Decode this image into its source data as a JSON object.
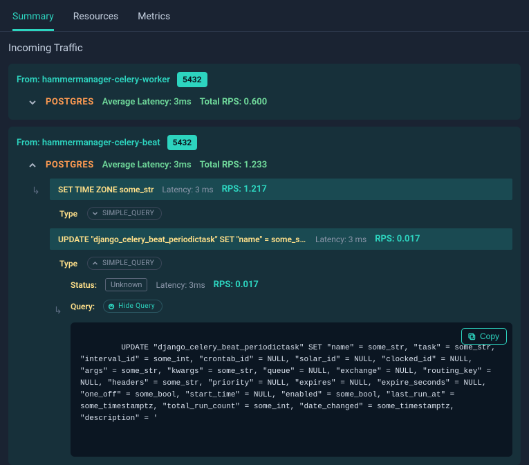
{
  "tabs": {
    "summary": "Summary",
    "resources": "Resources",
    "metrics": "Metrics"
  },
  "section_title": "Incoming Traffic",
  "sources": [
    {
      "from_label": "From: hammermanager-celery-worker",
      "port": "5432",
      "proto": "POSTGRES",
      "latency": "Average Latency: 3ms",
      "rps": "Total RPS: 0.600",
      "expanded": false
    },
    {
      "from_label": "From: hammermanager-celery-beat",
      "port": "5432",
      "proto": "POSTGRES",
      "latency": "Average Latency: 3ms",
      "rps": "Total RPS: 1.233",
      "expanded": true,
      "queries": [
        {
          "text": "SET TIME ZONE some_str",
          "latency": "Latency: 3 ms",
          "rps": "RPS: 1.217",
          "type_label": "Type",
          "type_value": "SIMPLE_QUERY"
        },
        {
          "text": "UPDATE \"django_celery_beat_periodictask\" SET \"name\" = some_str, \"task...",
          "latency": "Latency: 3 ms",
          "rps": "RPS: 0.017",
          "type_label": "Type",
          "type_value": "SIMPLE_QUERY",
          "status_label": "Status:",
          "status_value": "Unknown",
          "status_latency": "Latency: 3ms",
          "status_rps": "RPS: 0.017",
          "query_label": "Query:",
          "hide_query": "Hide Query",
          "full_query": " UPDATE \"django_celery_beat_periodictask\" SET \"name\" = some_str, \"task\" = some_str, \"interval_id\" = some_int, \"crontab_id\" = NULL, \"solar_id\" = NULL, \"clocked_id\" = NULL, \"args\" = some_str, \"kwargs\" = some_str, \"queue\" = NULL, \"exchange\" = NULL, \"routing_key\" = NULL, \"headers\" = some_str, \"priority\" = NULL, \"expires\" = NULL, \"expire_seconds\" = NULL, \"one_off\" = some_bool, \"start_time\" = NULL, \"enabled\" = some_bool, \"last_run_at\" = some_timestamptz, \"total_run_count\" = some_int, \"date_changed\" = some_timestamptz, \"description\" = '",
          "copy_label": "Copy"
        }
      ]
    }
  ]
}
